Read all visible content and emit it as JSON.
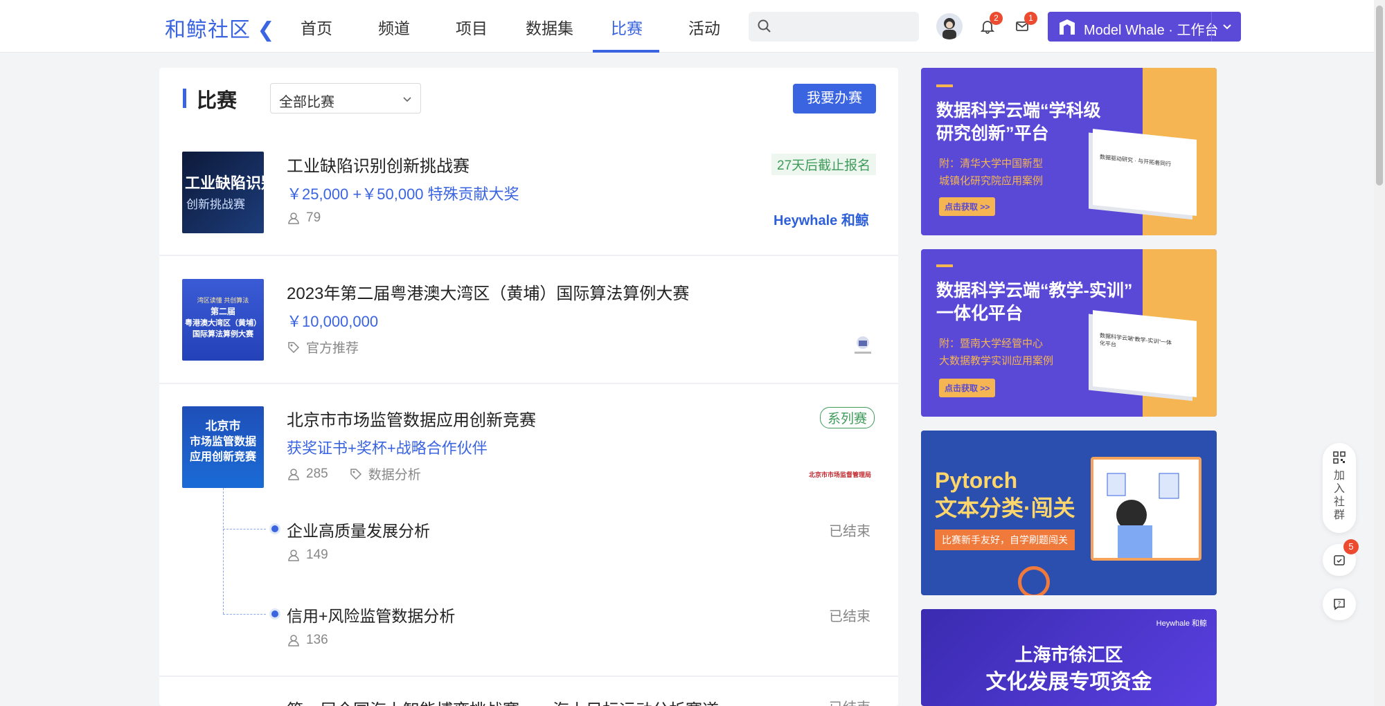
{
  "header": {
    "logo": "和鲸社区",
    "nav": [
      "首页",
      "频道",
      "项目",
      "数据集",
      "比赛",
      "活动"
    ],
    "active_nav": "比赛",
    "notifications_count": "2",
    "messages_count": "1",
    "workbench_brand": "Model Whale",
    "workbench_label": "工作台",
    "workbench_full": "Model Whale · 工作台"
  },
  "page": {
    "title": "比赛",
    "filter_selected": "全部比赛",
    "host_button": "我要办赛"
  },
  "competitions": [
    {
      "thumb_text": [
        "工业缺陷识别",
        "创新挑战赛"
      ],
      "title": "工业缺陷识别创新挑战赛",
      "prize": "￥25,000 +￥50,000 特殊贡献大奖",
      "participants": "79",
      "status": "27天后截止报名",
      "organizer": "Heywhale 和鲸"
    },
    {
      "thumb_text": [
        "湾区读懂 共创算法",
        "第二届",
        "粤港澳大湾区（黄埔）",
        "国际算法算例大赛"
      ],
      "title": "2023年第二届粤港澳大湾区（黄埔）国际算法算例大赛",
      "prize": "￥10,000,000",
      "tag": "官方推荐"
    },
    {
      "thumb_text": [
        "北京市",
        "市场监管数据",
        "应用创新竞赛"
      ],
      "title": "北京市市场监管数据应用创新竞赛",
      "prize": "获奖证书+奖杯+战略合作伙伴",
      "participants": "285",
      "tag": "数据分析",
      "status": "系列赛",
      "organizer": "北京市市场监督管理局",
      "sub_competitions": [
        {
          "title": "企业高质量发展分析",
          "participants": "149",
          "status": "已结束"
        },
        {
          "title": "信用+风险监管数据分析",
          "participants": "136",
          "status": "已结束"
        }
      ]
    },
    {
      "title": "第一届全国海上智能博弈挑战赛——海上目标运动分析赛道",
      "status": "已结束"
    }
  ],
  "ads": [
    {
      "headline": [
        "数据科学云端“学科级",
        "研究创新”平台"
      ],
      "sub": [
        "附：清华大学中国新型",
        "城镇化研究院应用案例"
      ],
      "cta": "点击获取 >>",
      "book_title": "数据驱动研究 · 与开拓者同行",
      "bg": "#5a49d6",
      "accent": "#f5b552"
    },
    {
      "headline": [
        "数据科学云端“教学-实训”",
        "一体化平台"
      ],
      "sub": [
        "附：暨南大学经管中心",
        "大数据教学实训应用案例"
      ],
      "cta": "点击获取 >>",
      "book_title": "数据科学云端“教学-实训”一体化平台",
      "bg": "#5a49d6",
      "accent": "#f5b552"
    },
    {
      "headline": [
        "Pytorch",
        "文本分类·闯关"
      ],
      "sub": [
        "比赛新手友好，自学刷题闯关"
      ],
      "bg": "#2b4fae",
      "accent": "#f5a25a"
    },
    {
      "brand": "Heywhale 和鲸",
      "headline": [
        "上海市徐汇区",
        "文化发展专项资金"
      ],
      "bg": "#3a2bb0"
    }
  ],
  "floating": {
    "join_group": "加入社群",
    "tasks_count": "5"
  },
  "colors": {
    "primary": "#3a64e0",
    "workbench": "#5b49d8",
    "badge": "#ec4b2f",
    "green": "#3e9b5a"
  }
}
